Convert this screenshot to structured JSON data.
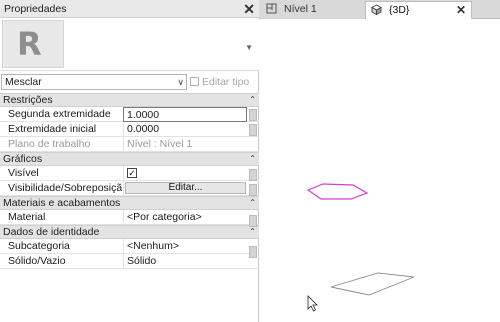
{
  "properties_panel": {
    "title": "Propriedades",
    "close_symbol": "✕",
    "logo_letter": "R",
    "type_selector": {
      "value": "Mesclar"
    },
    "edit_type_label": "Editar tipo",
    "categories": [
      {
        "name": "Restrições",
        "rows": [
          {
            "label": "Segunda extremidade",
            "value": "1.0000",
            "editing": true
          },
          {
            "label": "Extremidade inicial",
            "value": "0.0000"
          },
          {
            "label": "Plano de trabalho",
            "value": "Nível : Nível 1",
            "disabled": true
          }
        ]
      },
      {
        "name": "Gráficos",
        "rows": [
          {
            "label": "Visível",
            "checkbox": "✓"
          },
          {
            "label": "Visibilidade/Sobreposiçã...",
            "button": "Editar..."
          }
        ]
      },
      {
        "name": "Materiais e acabamentos",
        "rows": [
          {
            "label": "Material",
            "value": "<Por categoria>"
          }
        ]
      },
      {
        "name": "Dados de identidade",
        "rows": [
          {
            "label": "Subcategoria",
            "value": "<Nenhum>"
          },
          {
            "label": "Sólido/Vazio",
            "value": "Sólido"
          }
        ]
      }
    ]
  },
  "view_tabs": [
    {
      "label": "Nível 1",
      "icon": "floor-plan-icon",
      "active": false
    },
    {
      "label": "{3D}",
      "icon": "3d-view-icon",
      "active": true,
      "close_symbol": "✕"
    }
  ],
  "colors": {
    "selection_magenta": "#d040d0",
    "outline_gray": "#8c8c8c",
    "header_gray": "#e3e3e3"
  }
}
